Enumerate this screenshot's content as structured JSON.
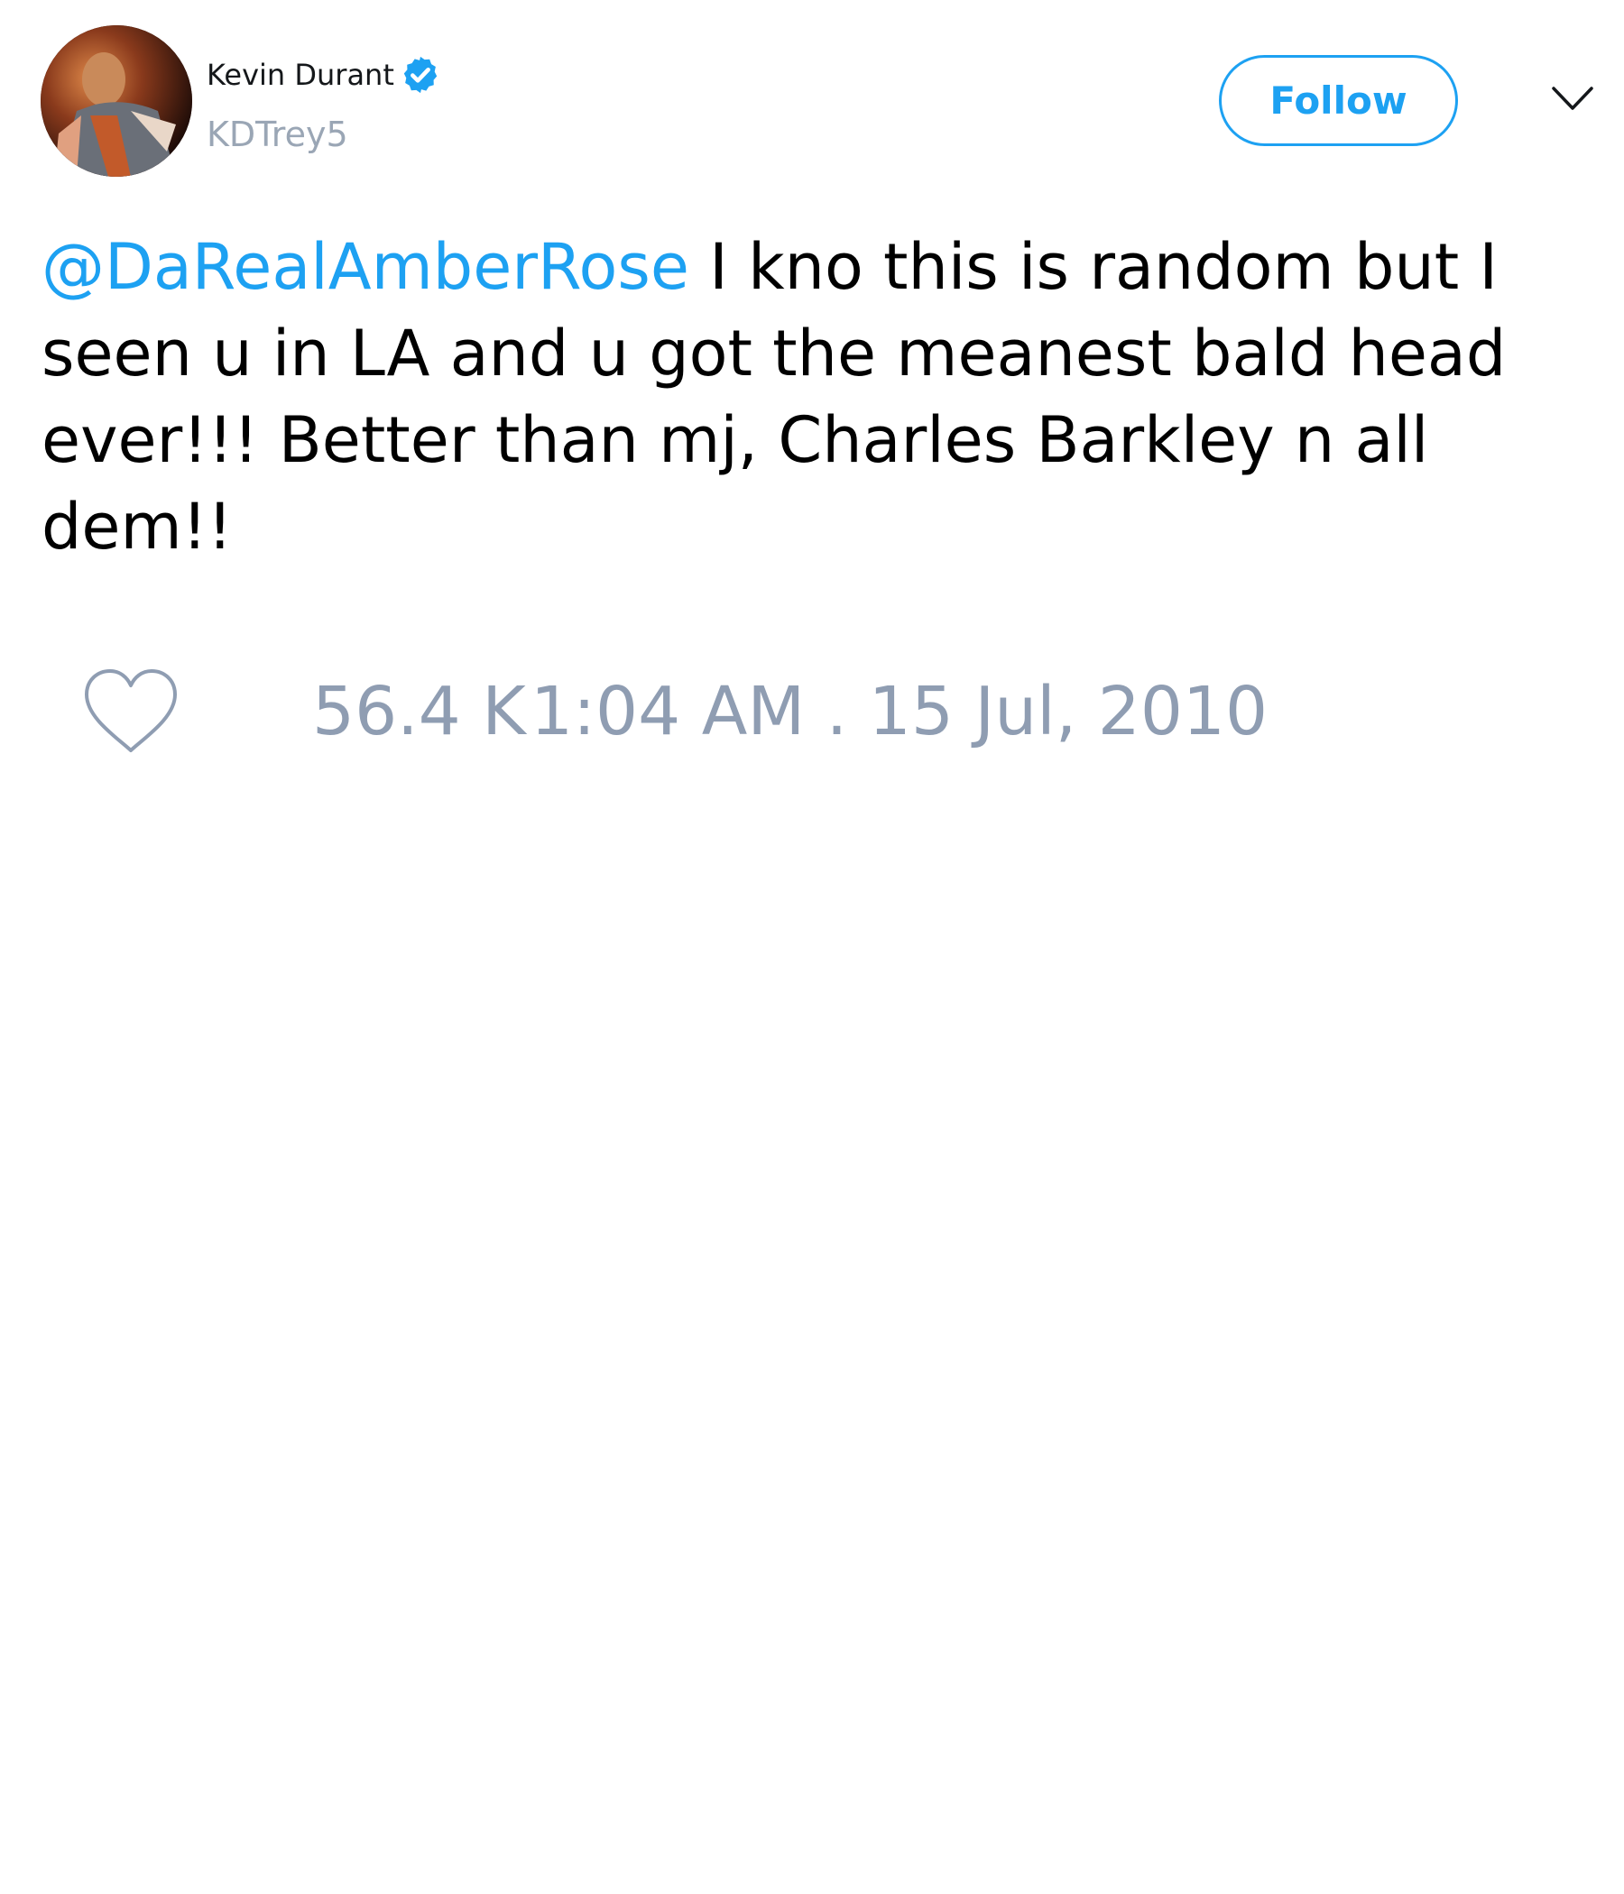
{
  "user": {
    "name": "Kevin Durant",
    "handle": "KDTrey5",
    "verified": true
  },
  "follow_button": {
    "label": "Follow"
  },
  "tweet": {
    "mention": "@DaRealAmberRose",
    "body": " I kno this is random but I seen u in LA and u got the meanest bald head ever!!! Better than mj, Charles Barkley n all dem!!"
  },
  "footer": {
    "like_count": "56.4 K",
    "timestamp": "1:04 AM . 15 Jul, 2010"
  },
  "icons": {
    "verified": "verified-badge-icon",
    "more": "chevron-down-icon",
    "like": "heart-icon"
  },
  "colors": {
    "accent": "#1da1f2",
    "text": "#000000",
    "muted": "#8f9db2"
  }
}
